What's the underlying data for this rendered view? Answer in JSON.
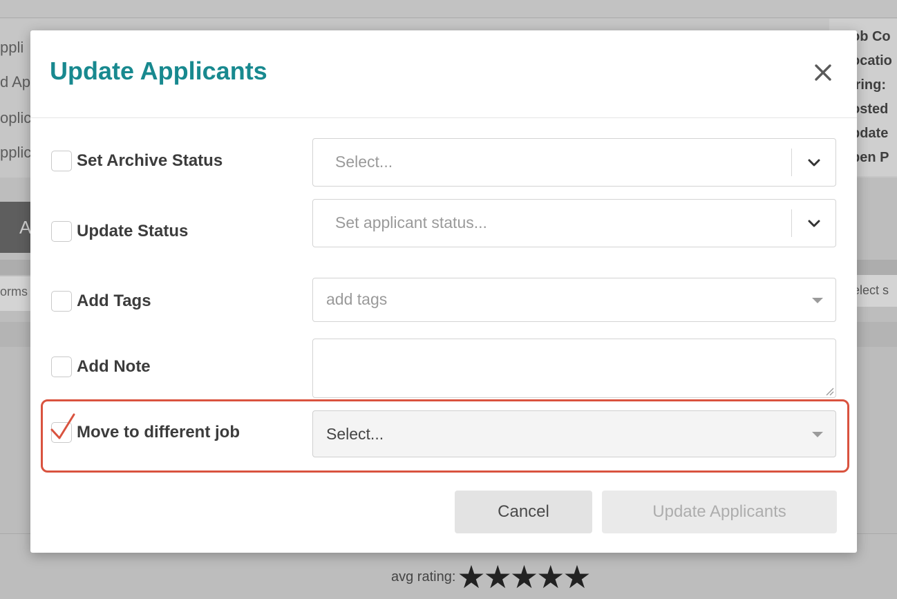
{
  "background": {
    "left_fragments": [
      "ppli",
      "d Ap",
      "oplic",
      "pplic"
    ],
    "right_fragments": [
      "ob Co",
      "ocatio",
      "iring:",
      "osted",
      "pdate",
      "pen P"
    ],
    "dark_button_text": "A",
    "forms_text": "orms",
    "select_text": "elect s",
    "rating_label": "avg rating:",
    "rating_stars": "★★★★★",
    "rating_value": 5
  },
  "modal": {
    "title": "Update Applicants",
    "close_icon": "close-x-icon",
    "rows": {
      "archive": {
        "label": "Set Archive Status",
        "placeholder": "Select...",
        "checked": false
      },
      "status": {
        "label": "Update Status",
        "placeholder": "Set applicant status...",
        "checked": false
      },
      "tags": {
        "label": "Add Tags",
        "placeholder": "add tags",
        "checked": false
      },
      "note": {
        "label": "Add Note",
        "value": "",
        "checked": false
      },
      "move": {
        "label": "Move to different job",
        "value": "Select...",
        "checked": true
      }
    },
    "buttons": {
      "cancel": "Cancel",
      "update": "Update Applicants"
    }
  },
  "colors": {
    "title": "#18898f",
    "highlight": "#d9533f",
    "overlay_bg": "#bdbdbd"
  }
}
